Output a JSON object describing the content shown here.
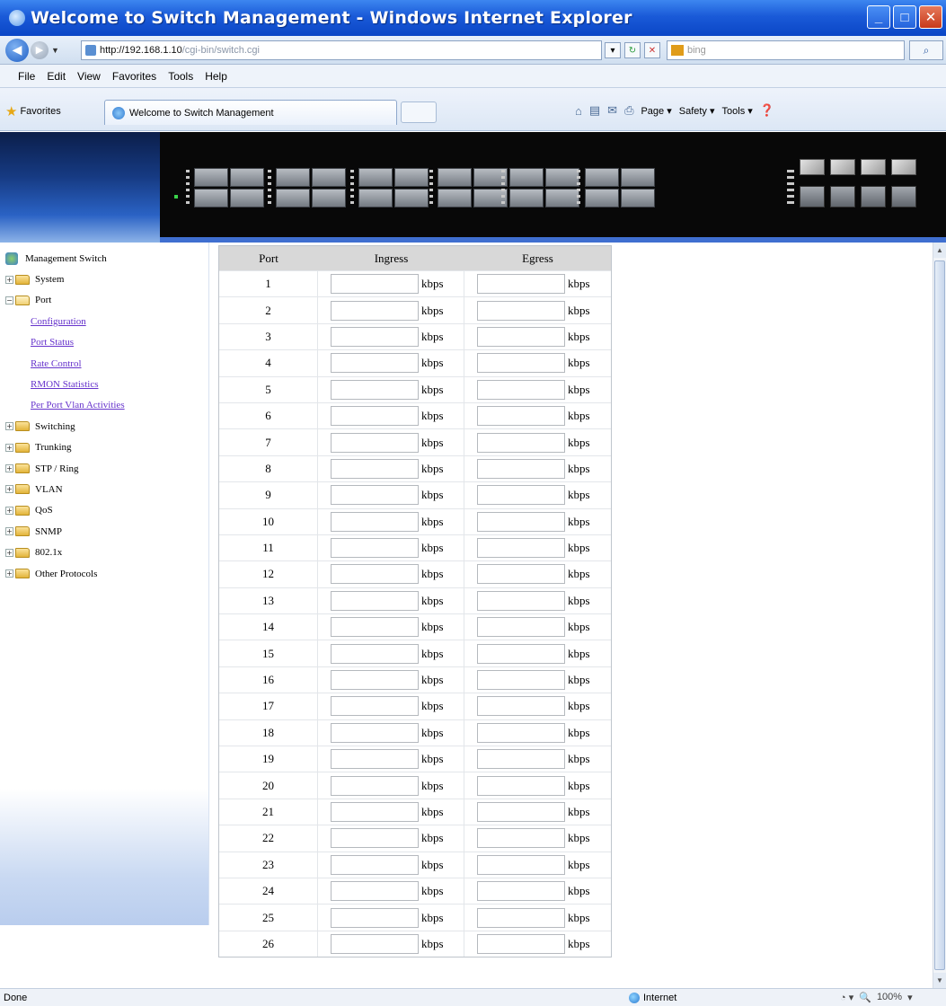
{
  "window": {
    "title": "Welcome to Switch Management - Windows Internet Explorer"
  },
  "addressbar": {
    "url_host": "http://192.168.1.10",
    "url_rest": "/cgi-bin/switch.cgi",
    "search_placeholder": "bing"
  },
  "menu": [
    "File",
    "Edit",
    "View",
    "Favorites",
    "Tools",
    "Help"
  ],
  "favorites": {
    "label": "Favorites",
    "tab_title": "Welcome to Switch Management",
    "commands": [
      "Page ▾",
      "Safety ▾",
      "Tools ▾"
    ]
  },
  "sidebar": {
    "root": "Management Switch",
    "items": [
      {
        "label": "System",
        "type": "folder",
        "expanded": false
      },
      {
        "label": "Port",
        "type": "folder",
        "expanded": true
      },
      {
        "label": "Configuration",
        "type": "link"
      },
      {
        "label": "Port Status",
        "type": "link"
      },
      {
        "label": "Rate Control",
        "type": "link"
      },
      {
        "label": "RMON Statistics",
        "type": "link"
      },
      {
        "label": "Per Port Vlan Activities",
        "type": "link"
      },
      {
        "label": "Switching",
        "type": "folder",
        "expanded": false
      },
      {
        "label": "Trunking",
        "type": "folder",
        "expanded": false
      },
      {
        "label": "STP / Ring",
        "type": "folder",
        "expanded": false
      },
      {
        "label": "VLAN",
        "type": "folder",
        "expanded": false
      },
      {
        "label": "QoS",
        "type": "folder",
        "expanded": false
      },
      {
        "label": "SNMP",
        "type": "folder",
        "expanded": false
      },
      {
        "label": "802.1x",
        "type": "folder",
        "expanded": false
      },
      {
        "label": "Other Protocols",
        "type": "folder",
        "expanded": false
      }
    ]
  },
  "table": {
    "headers": {
      "port": "Port",
      "ingress": "Ingress",
      "egress": "Egress"
    },
    "unit": "kbps",
    "rows": [
      {
        "port": "1",
        "ingress": "",
        "egress": ""
      },
      {
        "port": "2",
        "ingress": "",
        "egress": ""
      },
      {
        "port": "3",
        "ingress": "",
        "egress": ""
      },
      {
        "port": "4",
        "ingress": "",
        "egress": ""
      },
      {
        "port": "5",
        "ingress": "",
        "egress": ""
      },
      {
        "port": "6",
        "ingress": "",
        "egress": ""
      },
      {
        "port": "7",
        "ingress": "",
        "egress": ""
      },
      {
        "port": "8",
        "ingress": "",
        "egress": ""
      },
      {
        "port": "9",
        "ingress": "",
        "egress": ""
      },
      {
        "port": "10",
        "ingress": "",
        "egress": ""
      },
      {
        "port": "11",
        "ingress": "",
        "egress": ""
      },
      {
        "port": "12",
        "ingress": "",
        "egress": ""
      },
      {
        "port": "13",
        "ingress": "",
        "egress": ""
      },
      {
        "port": "14",
        "ingress": "",
        "egress": ""
      },
      {
        "port": "15",
        "ingress": "",
        "egress": ""
      },
      {
        "port": "16",
        "ingress": "",
        "egress": ""
      },
      {
        "port": "17",
        "ingress": "",
        "egress": ""
      },
      {
        "port": "18",
        "ingress": "",
        "egress": ""
      },
      {
        "port": "19",
        "ingress": "",
        "egress": ""
      },
      {
        "port": "20",
        "ingress": "",
        "egress": ""
      },
      {
        "port": "21",
        "ingress": "",
        "egress": ""
      },
      {
        "port": "22",
        "ingress": "",
        "egress": ""
      },
      {
        "port": "23",
        "ingress": "",
        "egress": ""
      },
      {
        "port": "24",
        "ingress": "",
        "egress": ""
      },
      {
        "port": "25",
        "ingress": "",
        "egress": ""
      },
      {
        "port": "26",
        "ingress": "",
        "egress": ""
      }
    ]
  },
  "status": {
    "left": "Done",
    "zone": "Internet",
    "zoom": "100%"
  }
}
